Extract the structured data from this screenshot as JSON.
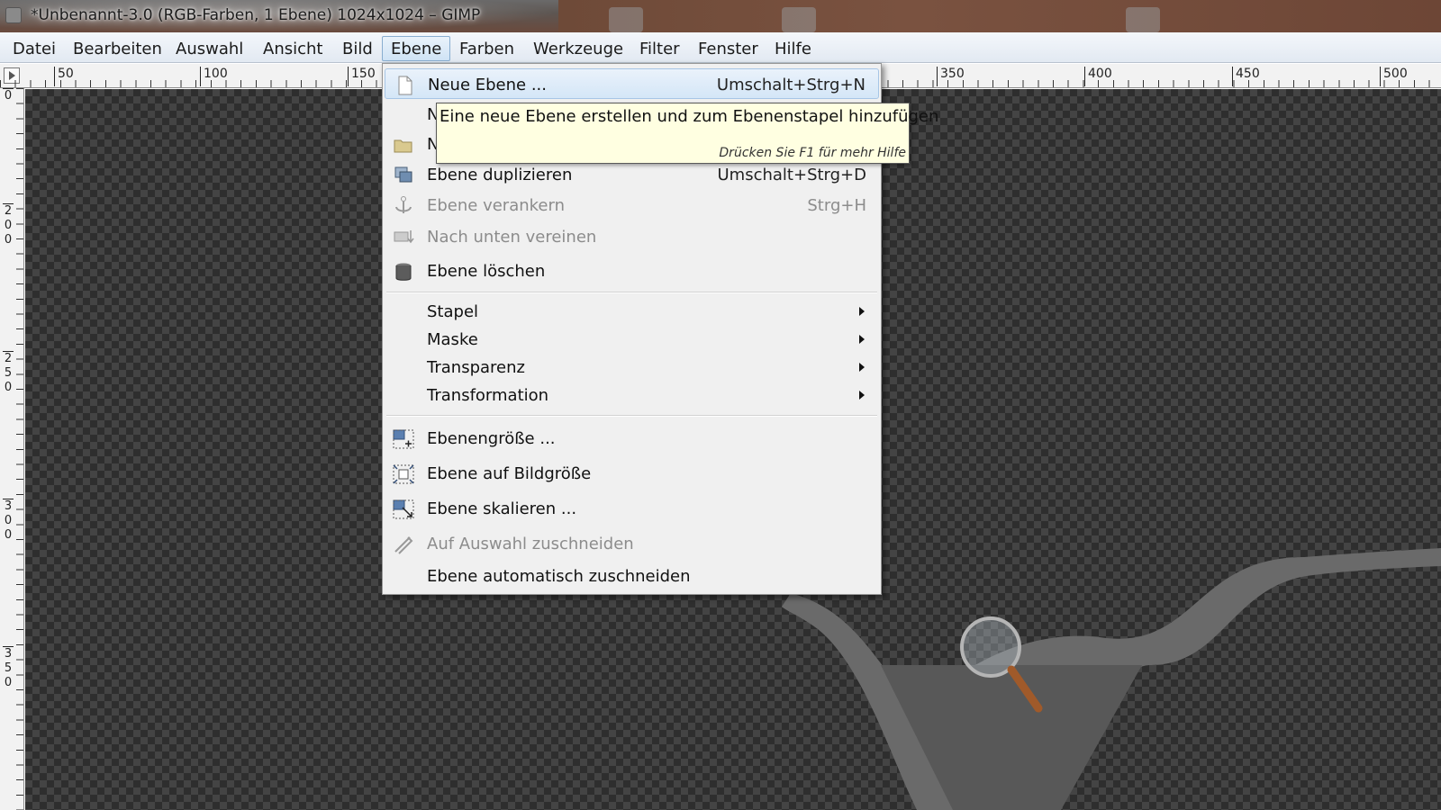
{
  "window": {
    "title": "*Unbenannt-3.0 (RGB-Farben, 1 Ebene) 1024x1024 – GIMP"
  },
  "menubar": {
    "items": [
      {
        "label": "Datei"
      },
      {
        "label": "Bearbeiten"
      },
      {
        "label": "Auswahl"
      },
      {
        "label": "Ansicht"
      },
      {
        "label": "Bild"
      },
      {
        "label": "Ebene",
        "active": true
      },
      {
        "label": "Farben"
      },
      {
        "label": "Werkzeuge"
      },
      {
        "label": "Filter"
      },
      {
        "label": "Fenster"
      },
      {
        "label": "Hilfe"
      }
    ]
  },
  "rulers": {
    "top_labels": [
      "50",
      "100",
      "150",
      "350",
      "400",
      "450",
      "500"
    ],
    "left_labels": [
      "0",
      "200",
      "250",
      "300",
      "350"
    ]
  },
  "ebene_menu": {
    "items": [
      {
        "label": "Neue Ebene ...",
        "shortcut": "Umschalt+Strg+N",
        "icon": "new-layer-icon",
        "enabled": true,
        "highlighted": true
      },
      {
        "label": "N",
        "shortcut": "",
        "icon": "",
        "enabled": true
      },
      {
        "label": "N",
        "shortcut": "",
        "icon": "folder-icon",
        "enabled": true
      },
      {
        "label": "Ebene duplizieren",
        "shortcut": "Umschalt+Strg+D",
        "icon": "duplicate-layer-icon",
        "enabled": true
      },
      {
        "label": "Ebene verankern",
        "shortcut": "Strg+H",
        "icon": "anchor-icon",
        "enabled": false
      },
      {
        "label": "Nach unten vereinen",
        "shortcut": "",
        "icon": "merge-down-icon",
        "enabled": false
      },
      {
        "label": "Ebene löschen",
        "shortcut": "",
        "icon": "trash-icon",
        "enabled": true
      },
      {
        "label": "Stapel",
        "submenu": true,
        "enabled": true
      },
      {
        "label": "Maske",
        "submenu": true,
        "enabled": true
      },
      {
        "label": "Transparenz",
        "submenu": true,
        "enabled": true
      },
      {
        "label": "Transformation",
        "submenu": true,
        "enabled": true
      },
      {
        "label": "Ebenengröße ...",
        "shortcut": "",
        "icon": "layer-size-icon",
        "enabled": true
      },
      {
        "label": "Ebene auf Bildgröße",
        "shortcut": "",
        "icon": "layer-to-image-size-icon",
        "enabled": true
      },
      {
        "label": "Ebene skalieren ...",
        "shortcut": "",
        "icon": "scale-layer-icon",
        "enabled": true
      },
      {
        "label": "Auf Auswahl zuschneiden",
        "shortcut": "",
        "icon": "crop-icon",
        "enabled": false
      },
      {
        "label": "Ebene automatisch zuschneiden",
        "shortcut": "",
        "icon": "",
        "enabled": true
      }
    ]
  },
  "tooltip": {
    "text": "Eine neue Ebene erstellen und zum Ebenenstapel hinzufügen",
    "help": "Drücken Sie F1 für mehr Hilfe"
  },
  "colors": {
    "menu_highlight": "#d4e6f7",
    "tooltip_bg": "#ffffe1",
    "checker_dark": "#2e2e2e",
    "checker_light": "#444444"
  }
}
